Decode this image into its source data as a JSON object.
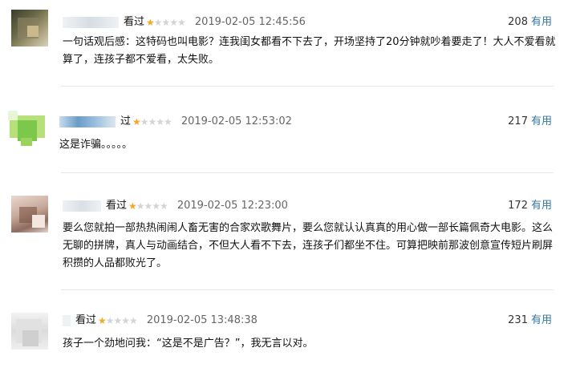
{
  "comments": [
    {
      "watched": "看过",
      "rating": 1,
      "stars_total": 5,
      "time": "2019-02-05 12:45:56",
      "votes": "208",
      "useful_label": "有用",
      "text": "一句话观后感：这特码也叫电影？连我闺女都看不下去了，开场坚持了20分钟就吵着要走了！大人不爱看就算了，连孩子都不爱看，太失败。"
    },
    {
      "watched": "过",
      "rating": 1,
      "stars_total": 5,
      "time": "2019-02-05 12:53:02",
      "votes": "217",
      "useful_label": "有用",
      "text": "这是诈骗。。。。。"
    },
    {
      "watched": "看过",
      "rating": 1,
      "stars_total": 5,
      "time": "2019-02-05 12:23:00",
      "votes": "172",
      "useful_label": "有用",
      "text": "要么您就拍一部热热闹闹人畜无害的合家欢歌舞片，要么您就认认真真的用心做一部长篇佩奇大电影。这么无聊的拼牌，真人与动画结合，不但大人看不下去，连孩子们都坐不住。可算把映前那波创意宣传短片刷屏积攒的人品都败光了。"
    },
    {
      "watched": "看过",
      "rating": 1,
      "stars_total": 5,
      "time": "2019-02-05 13:48:38",
      "votes": "231",
      "useful_label": "有用",
      "text": "孩子一个劲地问我：“这是不是广告？”，我无言以对。"
    }
  ],
  "colors": {
    "star_on": "#f5a623",
    "star_off": "#d4d4d4",
    "link": "#3377aa"
  },
  "icons": [
    "star-icon",
    "avatar-blurred"
  ]
}
